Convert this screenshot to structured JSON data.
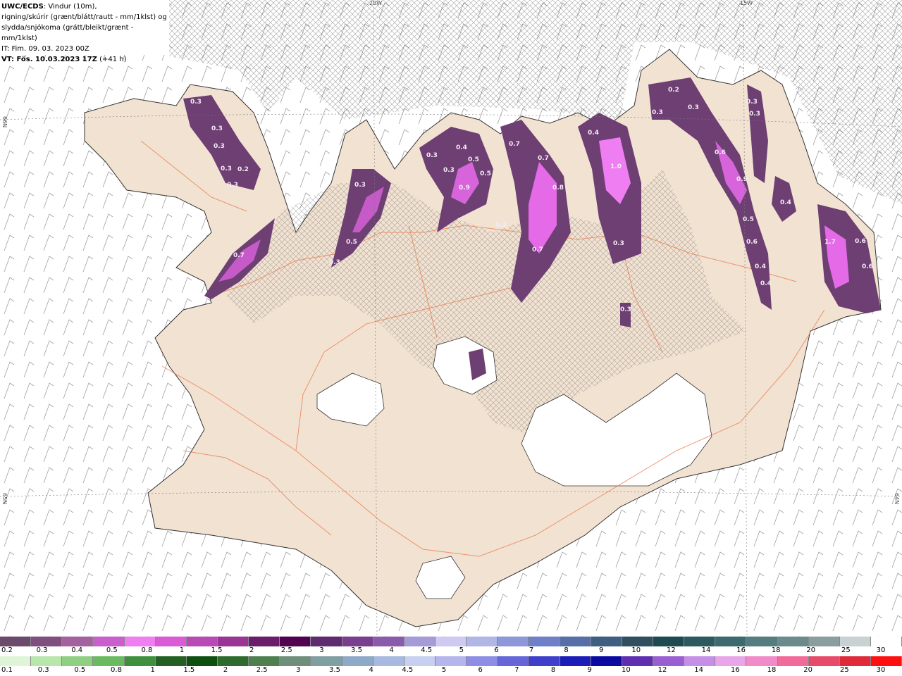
{
  "header": {
    "title_bold": "UWC/ECDS",
    "title_rest": ": Vindur (10m),",
    "line2": "rigning/skúrir (grænt/blátt/rautt - mm/1klst) og",
    "line3": "slydda/snjókoma (grátt/bleikt/grænt - mm/1klst)",
    "line4": "IT: Fim. 09. 03. 2023 00Z",
    "line5_bold": "VT: Fös. 10.03.2023 17Z",
    "line5_rest": " (+41 h)"
  },
  "grid_labels": {
    "top_20w": "20W",
    "top_15w": "15W",
    "left_66n": "66N",
    "left_65n": "65N",
    "right_64n": "64N"
  },
  "map_values": [
    {
      "label": "0.3"
    },
    {
      "label": "0.3"
    },
    {
      "label": "0.3"
    },
    {
      "label": "0.3"
    },
    {
      "label": "0.2"
    },
    {
      "label": "0.3"
    },
    {
      "label": "0.7"
    },
    {
      "label": "0.3"
    },
    {
      "label": "0.5"
    },
    {
      "label": "0.3"
    },
    {
      "label": "0.3"
    },
    {
      "label": "0.4"
    },
    {
      "label": "0.3"
    },
    {
      "label": "0.5"
    },
    {
      "label": "0.5"
    },
    {
      "label": "0.9"
    },
    {
      "label": "0.3"
    },
    {
      "label": "0.7"
    },
    {
      "label": "0.7"
    },
    {
      "label": "0.8"
    },
    {
      "label": "0.7"
    },
    {
      "label": "0.4"
    },
    {
      "label": "1.0"
    },
    {
      "label": "0.3"
    },
    {
      "label": "0.2"
    },
    {
      "label": "0.3"
    },
    {
      "label": "0.3"
    },
    {
      "label": "0.3"
    },
    {
      "label": "0.3"
    },
    {
      "label": "0.6"
    },
    {
      "label": "0.9"
    },
    {
      "label": "0.5"
    },
    {
      "label": "0.6"
    },
    {
      "label": "0.4"
    },
    {
      "label": "0.4"
    },
    {
      "label": "0.4"
    },
    {
      "label": "1.7"
    },
    {
      "label": "0.6"
    },
    {
      "label": "0.6"
    },
    {
      "label": "0.3"
    }
  ],
  "legend_snow": {
    "colors": [
      "#6b4a6b",
      "#7f4f80",
      "#a4619f",
      "#c85fcb",
      "#ef7ef0",
      "#d95bd6",
      "#b84ab5",
      "#9a3596",
      "#6a1d6b",
      "#520052",
      "#5f2a70",
      "#7a3e8f",
      "#8a5aab",
      "#a59bd7",
      "#cfcaf2",
      "#b0b6e6",
      "#8c98d8",
      "#6f7fc8",
      "#566fa8",
      "#3f5f80",
      "#2f4f60",
      "#1f4a4f",
      "#2d5a5f",
      "#3d6a6e",
      "#557c7f",
      "#6a8a8c",
      "#8a9ea0",
      "#c8d2d3",
      "#ffffff"
    ],
    "ticks": [
      "0.2",
      "0.3",
      "0.4",
      "0.5",
      "0.8",
      "1",
      "1.5",
      "2",
      "2.5",
      "3",
      "3.5",
      "4",
      "4.5",
      "5",
      "6",
      "7",
      "8",
      "9",
      "10",
      "12",
      "14",
      "16",
      "18",
      "20",
      "25",
      "30"
    ]
  },
  "legend_rain": {
    "colors": [
      "#dff5d8",
      "#b9e6ad",
      "#8fcf82",
      "#6aba61",
      "#3f8f3f",
      "#245f24",
      "#0f4f0f",
      "#2f6a2f",
      "#4f7f4f",
      "#6f8f7a",
      "#7f9fa0",
      "#8fa9c8",
      "#a7b9e0",
      "#c7d0f0",
      "#b6b6ee",
      "#8e8ee6",
      "#6666d9",
      "#3f3fcc",
      "#1c1cb8",
      "#0a0aa0",
      "#5f2fb0",
      "#9a5fd0",
      "#c58fe8",
      "#e8a5e8",
      "#f08ac8",
      "#f06a9a",
      "#e84a6a",
      "#e02a3a",
      "#ff1010"
    ],
    "ticks": [
      "0.1",
      "0.3",
      "0.5",
      "0.8",
      "1",
      "1.5",
      "2",
      "2.5",
      "3",
      "3.5",
      "4",
      "4.5",
      "5",
      "6",
      "7",
      "8",
      "9",
      "10",
      "12",
      "14",
      "16",
      "18",
      "20",
      "25",
      "30"
    ]
  },
  "colors": {
    "land": "#f2e2d2",
    "ocean": "#ffffff",
    "roads": "#e9784a",
    "snow_dark": "#6d3f73",
    "snow_mid": "#a24fa8",
    "snow_light": "#ec6ef2",
    "glacier": "#ffffff"
  }
}
